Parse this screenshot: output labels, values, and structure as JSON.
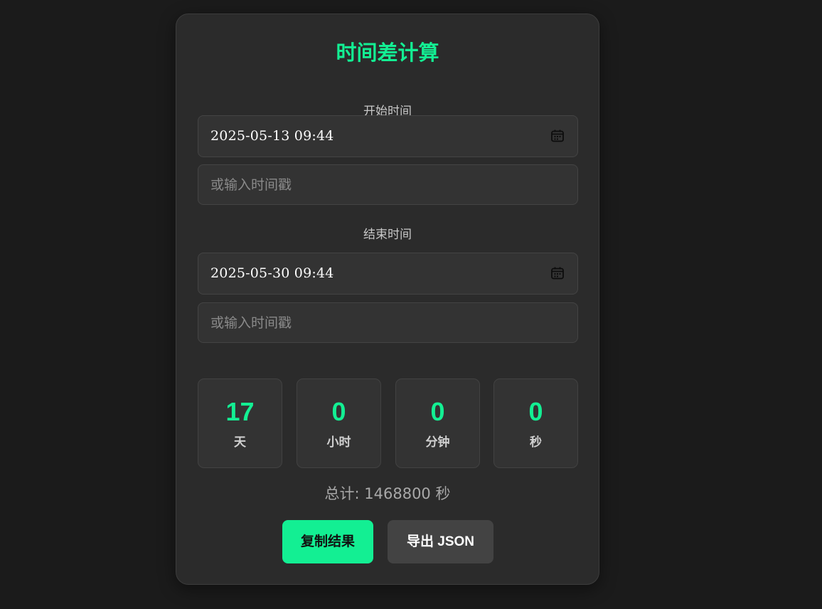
{
  "title": "时间差计算",
  "start": {
    "label": "开始时间",
    "datetime_value": "2025-05-13 09:44",
    "timestamp_placeholder": "或输入时间戳"
  },
  "end": {
    "label": "结束时间",
    "datetime_value": "2025-05-30 09:44",
    "timestamp_placeholder": "或输入时间戳"
  },
  "result": {
    "days": {
      "value": "17",
      "unit": "天"
    },
    "hours": {
      "value": "0",
      "unit": "小时"
    },
    "minutes": {
      "value": "0",
      "unit": "分钟"
    },
    "seconds": {
      "value": "0",
      "unit": "秒"
    },
    "total": "总计: 1468800 秒"
  },
  "buttons": {
    "copy_label": "复制结果",
    "export_label": "导出 JSON"
  },
  "colors": {
    "accent": "#13ef93",
    "background": "#1b1b1b",
    "card": "#2b2b2b"
  },
  "icons": {
    "date_picker": "calendar-icon"
  }
}
